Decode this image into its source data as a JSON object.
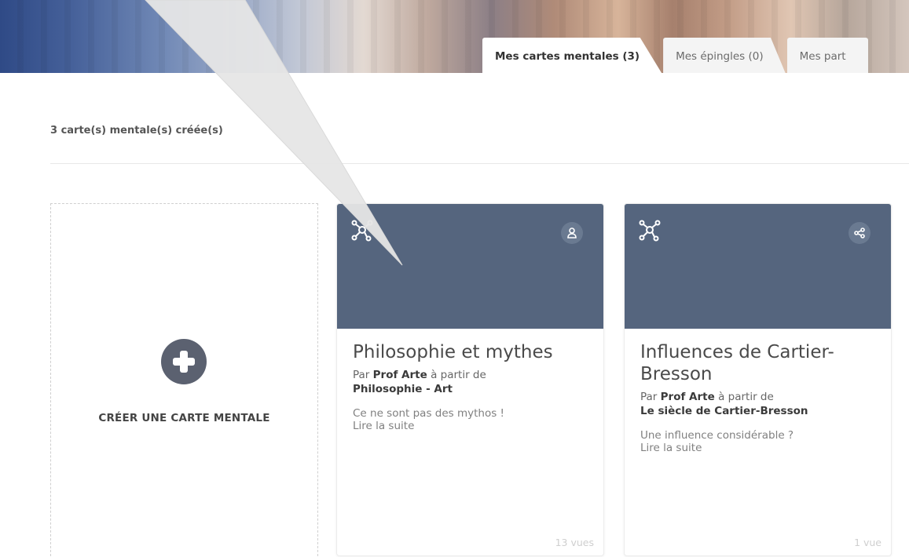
{
  "tabs": [
    {
      "label": "Mes cartes mentales (3)",
      "active": true
    },
    {
      "label": "Mes épingles (0)",
      "active": false
    },
    {
      "label": "Mes part",
      "active": false
    }
  ],
  "summary": "3 carte(s) mentale(s) créée(s)",
  "create_card": {
    "label": "CRÉER UNE CARTE MENTALE",
    "icon": "plus-circle-icon"
  },
  "cards": [
    {
      "title": "Philosophie et mythes",
      "by_prefix": "Par",
      "author": "Prof Arte",
      "by_suffix": "à partir de",
      "source": "Philosophie - Art",
      "excerpt": "Ce ne sont pas des mythos !",
      "more": "Lire la suite",
      "views": "13 vues",
      "badge_icon": "user-icon"
    },
    {
      "title": "Influences de Cartier-Bresson",
      "by_prefix": "Par",
      "author": "Prof Arte",
      "by_suffix": "à partir de",
      "source": "Le siècle de Cartier-Bresson",
      "excerpt": "Une influence considérable ?",
      "more": "Lire la suite",
      "views": "1 vue",
      "badge_icon": "share-icon"
    }
  ],
  "colors": {
    "card_header": "#55657e",
    "badge": "#6a7a91",
    "plus_circle": "#5b6170"
  }
}
